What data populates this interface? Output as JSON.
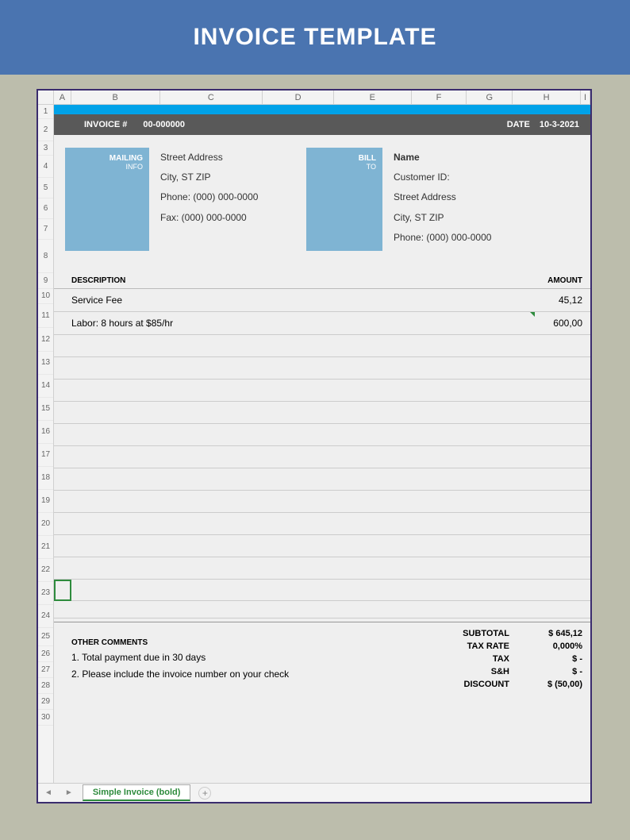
{
  "banner": {
    "title": "INVOICE TEMPLATE"
  },
  "columns": [
    "A",
    "B",
    "C",
    "D",
    "E",
    "F",
    "G",
    "H",
    "I"
  ],
  "rows": [
    "1",
    "2",
    "3",
    "4",
    "5",
    "6",
    "7",
    "8",
    "9",
    "10",
    "11",
    "12",
    "13",
    "14",
    "15",
    "16",
    "17",
    "18",
    "19",
    "20",
    "21",
    "22",
    "23",
    "24",
    "25",
    "26",
    "27",
    "28",
    "29",
    "30"
  ],
  "header": {
    "invoice_label": "INVOICE #",
    "invoice_number": "00-000000",
    "date_label": "DATE",
    "date_value": "10-3-2021"
  },
  "mailing": {
    "box_title": "MAILING",
    "box_sub": "INFO",
    "lines": [
      "Street Address",
      "City, ST  ZIP",
      "Phone: (000) 000-0000",
      "Fax: (000) 000-0000"
    ]
  },
  "billto": {
    "box_title": "BILL",
    "box_sub": "TO",
    "lines": [
      "Name",
      "Customer ID:",
      "Street Address",
      "City, ST  ZIP",
      "Phone: (000) 000-0000"
    ]
  },
  "table": {
    "desc_label": "DESCRIPTION",
    "amt_label": "AMOUNT",
    "items": [
      {
        "desc": "Service Fee",
        "amount": "45,12"
      },
      {
        "desc": "Labor: 8 hours at $85/hr",
        "amount": "600,00"
      }
    ]
  },
  "comments": {
    "title": "OTHER COMMENTS",
    "lines": [
      "1. Total payment due in 30 days",
      "2. Please include the invoice number on your check"
    ]
  },
  "totals": [
    {
      "label": "SUBTOTAL",
      "value": "$    645,12"
    },
    {
      "label": "TAX RATE",
      "value": "0,000%"
    },
    {
      "label": "TAX",
      "value": "$         -"
    },
    {
      "label": "S&H",
      "value": "$         -"
    },
    {
      "label": "DISCOUNT",
      "value": "$   (50,00)"
    }
  ],
  "tabs": {
    "active": "Simple Invoice (bold)"
  }
}
